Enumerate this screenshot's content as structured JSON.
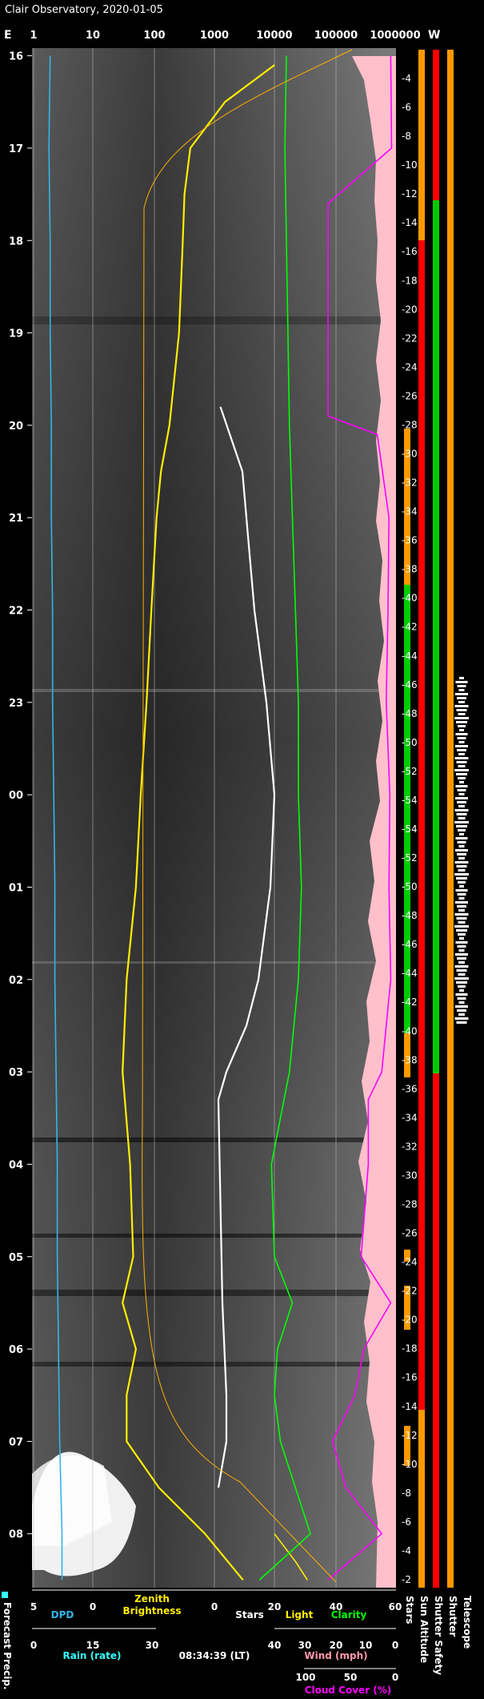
{
  "title": "Clair Observatory, 2020-01-05",
  "compass": {
    "left": "E",
    "right": "W"
  },
  "top_axis": {
    "scale": "log",
    "ticks": [
      "1",
      "10",
      "100",
      "1000",
      "10000",
      "100000",
      "1000000"
    ]
  },
  "time_labels": [
    "16",
    "17",
    "18",
    "19",
    "20",
    "21",
    "22",
    "23",
    "00",
    "01",
    "02",
    "03",
    "04",
    "05",
    "06",
    "07",
    "08"
  ],
  "altitude_labels": [
    "-4",
    "-6",
    "-8",
    "-10",
    "-12",
    "-14",
    "-16",
    "-18",
    "-20",
    "-22",
    "-24",
    "-26",
    "-28",
    "-30",
    "-32",
    "-34",
    "-36",
    "-38",
    "-40",
    "-42",
    "-44",
    "-46",
    "-48",
    "-50",
    "-52",
    "-54",
    "-54",
    "-52",
    "-50",
    "-48",
    "-46",
    "-44",
    "-42",
    "-40",
    "-38",
    "-36",
    "-34",
    "-32",
    "-30",
    "-28",
    "-26",
    "-24",
    "-22",
    "-20",
    "-18",
    "-16",
    "-14",
    "-12",
    "-10",
    "-8",
    "-6",
    "-4",
    "-2"
  ],
  "bottom_axes": {
    "dpd": {
      "ticks": [
        "5",
        "0"
      ],
      "label": "DPD"
    },
    "zenith": {
      "label_line1": "Zenith",
      "label_line2": "Brightness"
    },
    "stars": {
      "ticks": [
        "0"
      ],
      "label": "Stars"
    },
    "light": {
      "ticks": [
        "20"
      ],
      "label": "Light"
    },
    "clarity": {
      "ticks": [
        "40",
        "60"
      ],
      "label": "Clarity"
    },
    "rain": {
      "ticks": [
        "0",
        "15",
        "30"
      ],
      "label": "Rain (rate)"
    },
    "timestamp": "08:34:39 (LT)",
    "wind": {
      "ticks": [
        "40",
        "30",
        "20",
        "10",
        "0"
      ],
      "label": "Wind (mph)"
    },
    "cloud": {
      "ticks": [
        "100",
        "50",
        "0"
      ],
      "label": "Cloud Cover (%)"
    }
  },
  "side_labels": {
    "forecast": "Forecast Precip.",
    "stars": "Stars",
    "sun_altitude": "Sun Altitude",
    "shutter_safety": "Shutter Safety",
    "shutter": "Shutter",
    "telescope": "Telescope"
  },
  "colors": {
    "dpd": "#33b5e5",
    "zenith": "#ffee00",
    "zenith_model": "#ffb000",
    "stars": "#ffffff",
    "light": "#ffee00",
    "clarity": "#00ff00",
    "rain": "#33ffff",
    "wind": "#ff99aa",
    "cloud": "#ff00ff",
    "status_red": "#ff0000",
    "status_orange": "#ff9900",
    "status_green": "#00cc00"
  },
  "chart_data": {
    "type": "line",
    "x_axis": "time (hours, local)",
    "x_range": [
      "15:55",
      "08:35"
    ],
    "series": [
      {
        "name": "DPD",
        "color": "#33b5e5",
        "points": [
          [
            16.0,
            3.6
          ],
          [
            17.0,
            3.7
          ],
          [
            18.0,
            3.6
          ],
          [
            19.0,
            3.6
          ],
          [
            20.0,
            3.5
          ],
          [
            21.0,
            3.5
          ],
          [
            22.0,
            3.4
          ],
          [
            23.0,
            3.4
          ],
          [
            24.0,
            3.3
          ],
          [
            25.0,
            3.2
          ],
          [
            26.0,
            3.2
          ],
          [
            27.0,
            3.1
          ],
          [
            28.0,
            3.0
          ],
          [
            29.0,
            3.0
          ],
          [
            30.0,
            2.9
          ],
          [
            31.0,
            2.8
          ],
          [
            32.0,
            2.6
          ],
          [
            32.5,
            2.6
          ]
        ]
      },
      {
        "name": "Zenith Brightness",
        "color": "#ffee00",
        "points": [
          [
            16.1,
            10000
          ],
          [
            16.5,
            1500
          ],
          [
            17.0,
            400
          ],
          [
            17.5,
            320
          ],
          [
            18.0,
            300
          ],
          [
            19.0,
            260
          ],
          [
            20.0,
            180
          ],
          [
            20.5,
            130
          ],
          [
            21.0,
            110
          ],
          [
            22.0,
            90
          ],
          [
            23.0,
            75
          ],
          [
            24.0,
            60
          ],
          [
            25.0,
            50
          ],
          [
            26.0,
            35
          ],
          [
            27.0,
            30
          ],
          [
            28.0,
            40
          ],
          [
            29.0,
            45
          ],
          [
            29.5,
            30
          ],
          [
            30.0,
            50
          ],
          [
            30.5,
            35
          ],
          [
            31.0,
            35
          ],
          [
            31.5,
            120
          ],
          [
            32.0,
            700
          ],
          [
            32.5,
            3000
          ]
        ]
      },
      {
        "name": "Stars",
        "color": "#ffffff",
        "points": [
          [
            19.8,
            1.5
          ],
          [
            20.5,
            7
          ],
          [
            21.0,
            8
          ],
          [
            22.0,
            10
          ],
          [
            23.0,
            13
          ],
          [
            24.0,
            15
          ],
          [
            25.0,
            14
          ],
          [
            26.0,
            11
          ],
          [
            26.5,
            8
          ],
          [
            27.0,
            3
          ],
          [
            27.3,
            1
          ],
          [
            29.5,
            2
          ],
          [
            30.5,
            3
          ],
          [
            31.0,
            3
          ],
          [
            31.5,
            1
          ]
        ]
      },
      {
        "name": "Light",
        "color": "#ffee00",
        "points": [
          [
            32.0,
            20
          ],
          [
            32.3,
            27
          ],
          [
            32.5,
            31
          ]
        ]
      },
      {
        "name": "Clarity",
        "color": "#00ff00",
        "points": [
          [
            16.0,
            24
          ],
          [
            17.0,
            23.5
          ],
          [
            18.0,
            24
          ],
          [
            19.0,
            24.5
          ],
          [
            20.0,
            25
          ],
          [
            21.0,
            26
          ],
          [
            22.0,
            27
          ],
          [
            23.0,
            28
          ],
          [
            24.0,
            28
          ],
          [
            25.0,
            29
          ],
          [
            26.0,
            28
          ],
          [
            27.0,
            25
          ],
          [
            28.0,
            19
          ],
          [
            29.0,
            20
          ],
          [
            29.5,
            26
          ],
          [
            30.0,
            21
          ],
          [
            30.5,
            20
          ],
          [
            31.0,
            22
          ],
          [
            31.5,
            27
          ],
          [
            32.0,
            32
          ],
          [
            32.5,
            15
          ]
        ]
      },
      {
        "name": "Cloud Cover (%)",
        "color": "#ff00ff",
        "points": [
          [
            16.0,
            5
          ],
          [
            17.0,
            4
          ],
          [
            17.6,
            75
          ],
          [
            19.9,
            75
          ],
          [
            20.1,
            20
          ],
          [
            21.0,
            7
          ],
          [
            22.0,
            8
          ],
          [
            23.0,
            10
          ],
          [
            24.0,
            6
          ],
          [
            25.0,
            7
          ],
          [
            26.0,
            5
          ],
          [
            27.0,
            15
          ],
          [
            27.3,
            30
          ],
          [
            28.0,
            30
          ],
          [
            29.0,
            38
          ],
          [
            29.5,
            5
          ],
          [
            30.0,
            35
          ],
          [
            30.5,
            45
          ],
          [
            31.0,
            70
          ],
          [
            31.5,
            55
          ],
          [
            32.0,
            15
          ],
          [
            32.5,
            75
          ]
        ]
      }
    ]
  }
}
